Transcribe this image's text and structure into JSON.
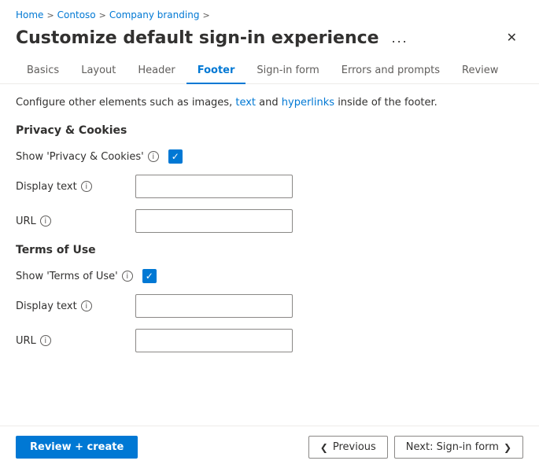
{
  "breadcrumb": {
    "items": [
      "Home",
      "Contoso",
      "Company branding"
    ],
    "separators": [
      ">",
      ">",
      ">"
    ]
  },
  "title": "Customize default sign-in experience",
  "ellipsis_label": "...",
  "close_label": "✕",
  "tabs": [
    {
      "id": "basics",
      "label": "Basics",
      "active": false
    },
    {
      "id": "layout",
      "label": "Layout",
      "active": false
    },
    {
      "id": "header",
      "label": "Header",
      "active": false
    },
    {
      "id": "footer",
      "label": "Footer",
      "active": true
    },
    {
      "id": "signin-form",
      "label": "Sign-in form",
      "active": false
    },
    {
      "id": "errors-prompts",
      "label": "Errors and prompts",
      "active": false
    },
    {
      "id": "review",
      "label": "Review",
      "active": false
    }
  ],
  "info_text": "Configure other elements such as images, text and hyperlinks inside of the footer.",
  "privacy_section": {
    "title": "Privacy & Cookies",
    "show_label": "Show 'Privacy & Cookies'",
    "show_checked": true,
    "display_text_label": "Display text",
    "display_text_value": "",
    "display_text_placeholder": "",
    "url_label": "URL",
    "url_value": "",
    "url_placeholder": ""
  },
  "terms_section": {
    "title": "Terms of Use",
    "show_label": "Show 'Terms of Use'",
    "show_checked": true,
    "display_text_label": "Display text",
    "display_text_value": "",
    "display_text_placeholder": "",
    "url_label": "URL",
    "url_value": "",
    "url_placeholder": ""
  },
  "footer": {
    "review_create_label": "Review + create",
    "previous_label": "Previous",
    "next_label": "Next: Sign-in form"
  },
  "icons": {
    "info": "i",
    "check": "✓",
    "chevron_left": "❮",
    "chevron_right": "❯"
  }
}
